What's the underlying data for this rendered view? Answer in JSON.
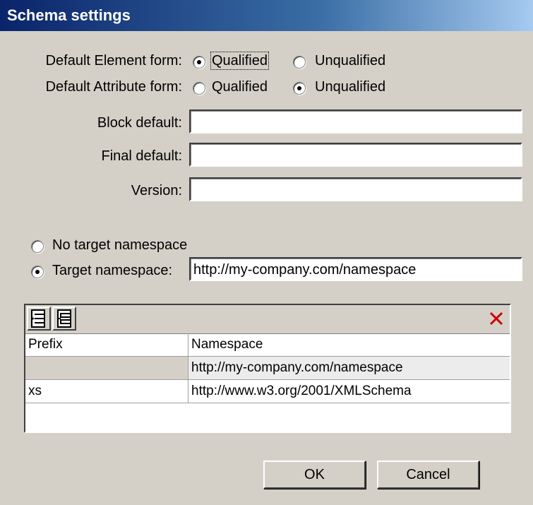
{
  "window": {
    "title": "Schema settings"
  },
  "form": {
    "element_form_label": "Default Element form:",
    "attribute_form_label": "Default Attribute form:",
    "qualified": "Qualified",
    "unqualified": "Unqualified",
    "element_form_selected": "Qualified",
    "attribute_form_selected": "Unqualified",
    "block_default_label": "Block default:",
    "block_default_value": "",
    "final_default_label": "Final default:",
    "final_default_value": "",
    "version_label": "Version:",
    "version_value": ""
  },
  "namespace": {
    "no_target_label": "No target namespace",
    "target_label": "Target namespace:",
    "target_value": "http://my-company.com/namespace",
    "selected": "target"
  },
  "grid": {
    "icons": [
      "insert-row-icon",
      "append-row-icon",
      "delete-row-icon"
    ],
    "columns": [
      "Prefix",
      "Namespace"
    ],
    "rows": [
      {
        "prefix": "",
        "namespace": "http://my-company.com/namespace"
      },
      {
        "prefix": "xs",
        "namespace": "http://www.w3.org/2001/XMLSchema"
      }
    ]
  },
  "buttons": {
    "ok": "OK",
    "cancel": "Cancel"
  },
  "colors": {
    "dialog_bg": "#d4d0c8",
    "title_start": "#0a246a",
    "title_end": "#a6caf0",
    "delete_icon": "#cc0000"
  }
}
